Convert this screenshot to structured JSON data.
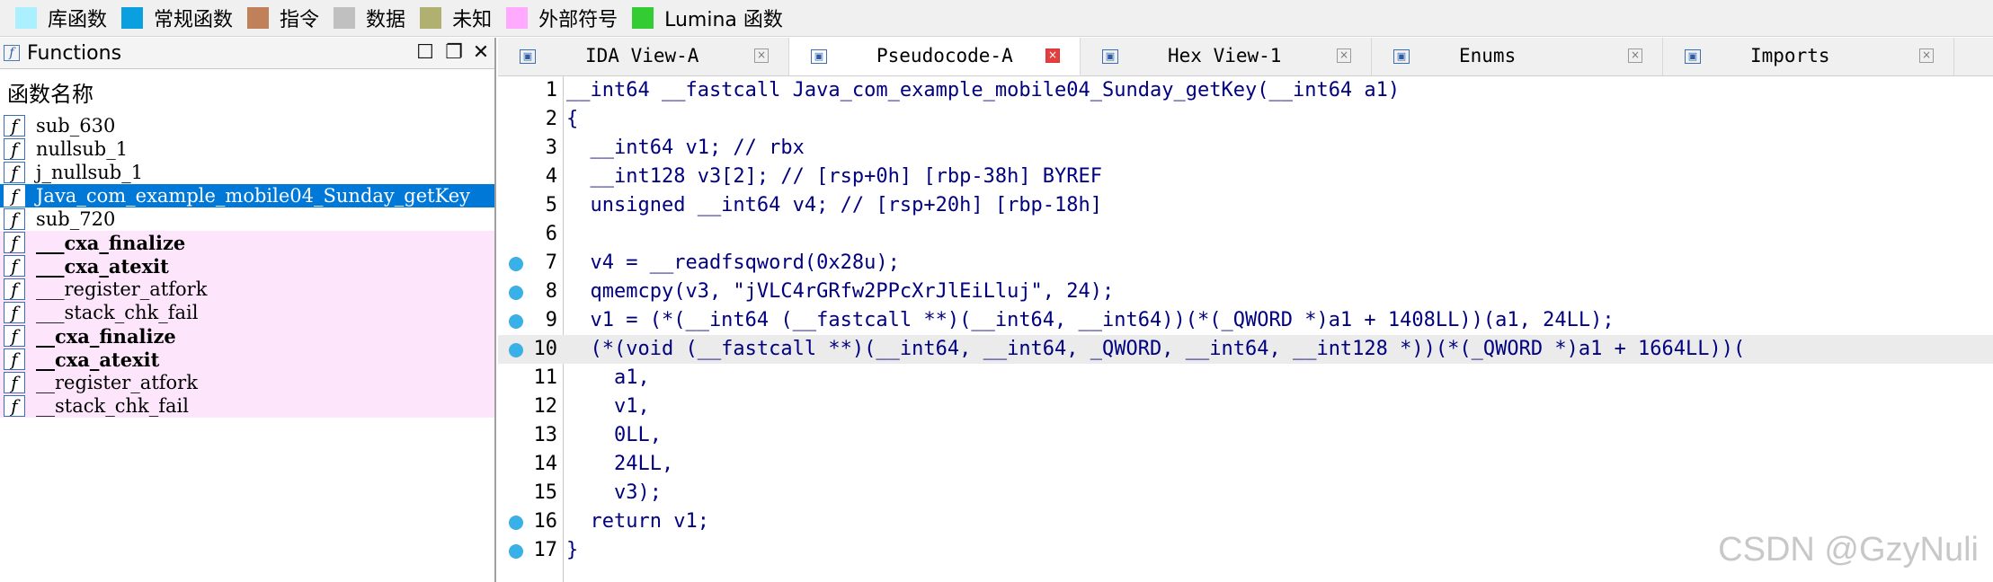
{
  "legend": [
    {
      "label": "库函数",
      "color": "#aaf0ff"
    },
    {
      "label": "常规函数",
      "color": "#0aa0e0"
    },
    {
      "label": "指令",
      "color": "#c0805a"
    },
    {
      "label": "数据",
      "color": "#c0c0c0"
    },
    {
      "label": "未知",
      "color": "#b0b070"
    },
    {
      "label": "外部符号",
      "color": "#ffaaff"
    },
    {
      "label": "Lumina 函数",
      "color": "#33cc33"
    }
  ],
  "functions_panel": {
    "title": "Functions",
    "column_header": "函数名称",
    "items": [
      {
        "name": "sub_630",
        "style": "normal"
      },
      {
        "name": "nullsub_1",
        "style": "normal"
      },
      {
        "name": "j_nullsub_1",
        "style": "normal"
      },
      {
        "name": "Java_com_example_mobile04_Sunday_getKey",
        "style": "selected"
      },
      {
        "name": "sub_720",
        "style": "normal"
      },
      {
        "name": "___cxa_finalize",
        "style": "pink-bold"
      },
      {
        "name": "___cxa_atexit",
        "style": "pink-bold"
      },
      {
        "name": "___register_atfork",
        "style": "pink"
      },
      {
        "name": "___stack_chk_fail",
        "style": "pink"
      },
      {
        "name": "__cxa_finalize",
        "style": "pink-bold"
      },
      {
        "name": "__cxa_atexit",
        "style": "pink-bold"
      },
      {
        "name": "__register_atfork",
        "style": "pink"
      },
      {
        "name": "__stack_chk_fail",
        "style": "pink"
      }
    ]
  },
  "tabs": [
    {
      "label": "IDA View-A",
      "icon": "ida-view-icon",
      "active": false
    },
    {
      "label": "Pseudocode-A",
      "icon": "pseudocode-icon",
      "active": true
    },
    {
      "label": "Hex View-1",
      "icon": "hex-view-icon",
      "active": false
    },
    {
      "label": "Enums",
      "icon": "enums-icon",
      "active": false
    },
    {
      "label": "Imports",
      "icon": "imports-icon",
      "active": false
    }
  ],
  "code": [
    {
      "n": "1",
      "bp": false,
      "hl": false,
      "t": "__int64 __fastcall Java_com_example_mobile04_Sunday_getKey(__int64 a1)"
    },
    {
      "n": "2",
      "bp": false,
      "hl": false,
      "t": "{"
    },
    {
      "n": "3",
      "bp": false,
      "hl": false,
      "t": "  __int64 v1; // rbx"
    },
    {
      "n": "4",
      "bp": false,
      "hl": false,
      "t": "  __int128 v3[2]; // [rsp+0h] [rbp-38h] BYREF"
    },
    {
      "n": "5",
      "bp": false,
      "hl": false,
      "t": "  unsigned __int64 v4; // [rsp+20h] [rbp-18h]"
    },
    {
      "n": "6",
      "bp": false,
      "hl": false,
      "t": ""
    },
    {
      "n": "7",
      "bp": true,
      "hl": false,
      "t": "  v4 = __readfsqword(0x28u);"
    },
    {
      "n": "8",
      "bp": true,
      "hl": false,
      "t": "  qmemcpy(v3, \"jVLC4rGRfw2PPcXrJlEiLluj\", 24);"
    },
    {
      "n": "9",
      "bp": true,
      "hl": false,
      "t": "  v1 = (*(__int64 (__fastcall **)(__int64, __int64))(*(_QWORD *)a1 + 1408LL))(a1, 24LL);"
    },
    {
      "n": "10",
      "bp": true,
      "hl": true,
      "t": "  (*(void (__fastcall **)(__int64, __int64, _QWORD, __int64, __int128 *))(*(_QWORD *)a1 + 1664LL))("
    },
    {
      "n": "11",
      "bp": false,
      "hl": false,
      "t": "    a1,"
    },
    {
      "n": "12",
      "bp": false,
      "hl": false,
      "t": "    v1,"
    },
    {
      "n": "13",
      "bp": false,
      "hl": false,
      "t": "    0LL,"
    },
    {
      "n": "14",
      "bp": false,
      "hl": false,
      "t": "    24LL,"
    },
    {
      "n": "15",
      "bp": false,
      "hl": false,
      "t": "    v3);"
    },
    {
      "n": "16",
      "bp": true,
      "hl": false,
      "t": "  return v1;"
    },
    {
      "n": "17",
      "bp": true,
      "hl": false,
      "t": "}"
    }
  ],
  "watermark": "CSDN @GzyNuli"
}
